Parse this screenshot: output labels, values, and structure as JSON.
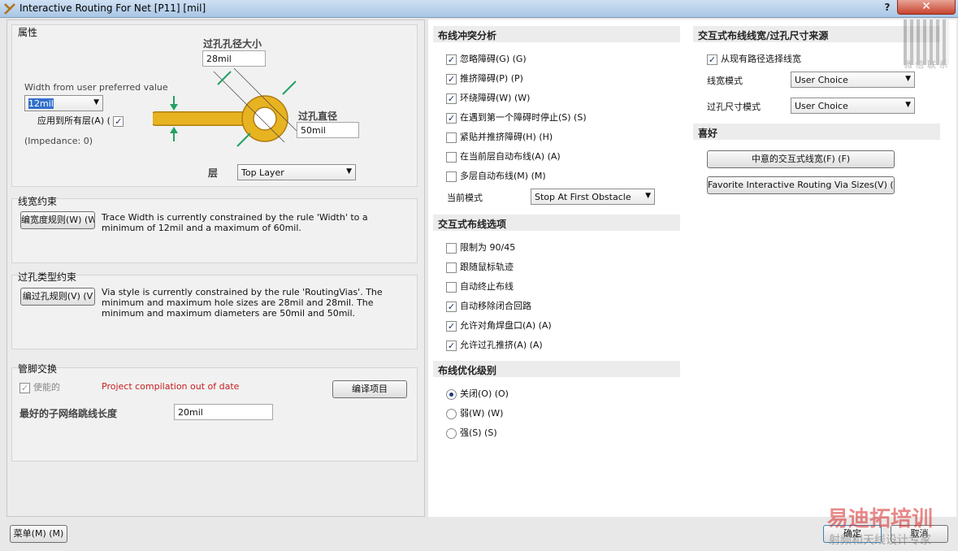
{
  "window": {
    "title": "Interactive Routing For Net [P11] [mil]",
    "help": "?",
    "close": "✕"
  },
  "properties": {
    "title": "属性",
    "via_hole_size_label": "过孔孔径大小",
    "via_hole_size_value": "28mil",
    "width_pref_label": "Width from user preferred value",
    "width_value": "12mil",
    "apply_all_layers": "应用到所有层(A) (",
    "impedance": "(Impedance: 0)",
    "via_diameter_label": "过孔直径",
    "via_diameter_value": "50mil",
    "layer_label": "层",
    "layer_value": "Top Layer"
  },
  "width_constraint": {
    "title": "线宽约束",
    "button": "编宽度规则(W) (W",
    "text": "Trace Width is currently constrained by the rule 'Width' to a minimum of 12mil and a maximum of 60mil."
  },
  "via_constraint": {
    "title": "过孔类型约束",
    "button": "编过孔规则(V) (V",
    "text": "Via style is currently constrained by the rule 'RoutingVias'. The minimum and maximum hole sizes are 28mil and 28mil. The minimum and maximum diameters are 50mil and 50mil."
  },
  "pin_swap": {
    "title": "管脚交换",
    "enabled_label": "使能的",
    "warning": "Project compilation out of date",
    "compile_button": "编译项目",
    "subnet_label": "最好的子网络跳线长度",
    "subnet_value": "20mil"
  },
  "conflict": {
    "title": "布线冲突分析",
    "items": [
      {
        "label": "忽略障碍(G) (G)",
        "checked": true
      },
      {
        "label": "推挤障碍(P) (P)",
        "checked": true
      },
      {
        "label": "环绕障碍(W) (W)",
        "checked": true
      },
      {
        "label": "在遇到第一个障碍时停止(S) (S)",
        "checked": true
      },
      {
        "label": "紧贴并推挤障碍(H) (H)",
        "checked": false
      },
      {
        "label": "在当前层自动布线(A) (A)",
        "checked": false
      },
      {
        "label": "多层自动布线(M) (M)",
        "checked": false
      }
    ],
    "mode_label": "当前模式",
    "mode_value": "Stop At First Obstacle"
  },
  "routing_options": {
    "title": "交互式布线选项",
    "items": [
      {
        "label": "限制为 90/45",
        "checked": false
      },
      {
        "label": "跟随鼠标轨迹",
        "checked": false
      },
      {
        "label": "自动终止布线",
        "checked": false
      },
      {
        "label": "自动移除闭合回路",
        "checked": true
      },
      {
        "label": "允许对角焊盘口(A) (A)",
        "checked": true
      },
      {
        "label": "允许过孔推挤(A) (A)",
        "checked": true
      }
    ]
  },
  "optimization": {
    "title": "布线优化级别",
    "items": [
      {
        "label": "关闭(O) (O)",
        "selected": true
      },
      {
        "label": "弱(W) (W)",
        "selected": false
      },
      {
        "label": "强(S) (S)",
        "selected": false
      }
    ]
  },
  "width_source": {
    "title": "交互式布线线宽/过孔尺寸来源",
    "pick_existing": "从现有路径选择线宽",
    "width_mode_label": "线宽模式",
    "width_mode_value": "User Choice",
    "via_mode_label": "过孔尺寸模式",
    "via_mode_value": "User Choice"
  },
  "favorites": {
    "title": "喜好",
    "width_button": "中意的交互式线宽(F) (F)",
    "via_button": "Favorite Interactive Routing Via Sizes(V) (V)"
  },
  "footer": {
    "menu": "菜单(M) (M)",
    "ok": "确定",
    "cancel": "取消"
  },
  "watermark": {
    "contact": "微 信 联 系",
    "brand": "易迪拓培训",
    "tagline": "射频和天线设计专家"
  },
  "colors": {
    "pad": "#e8b321",
    "arrow": "#23a163",
    "warning": "#c62020"
  }
}
